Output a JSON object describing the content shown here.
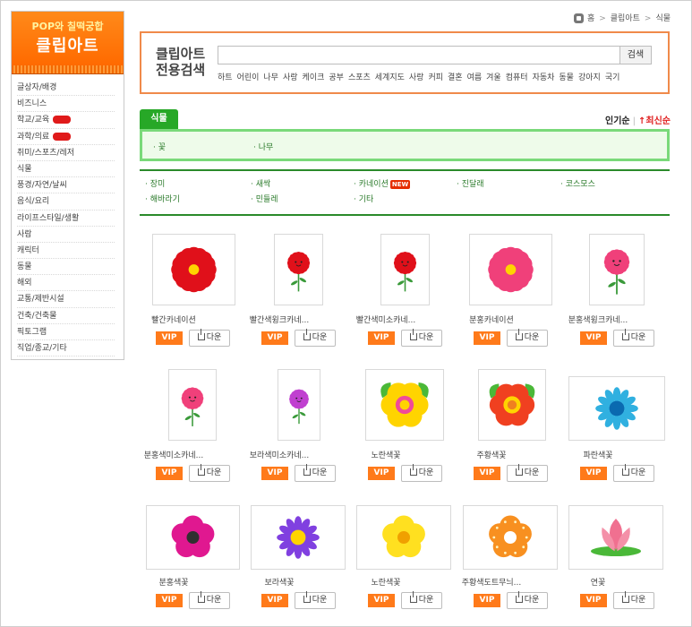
{
  "sidebar": {
    "logo_sub": "POP와 칠떡궁합",
    "logo_main": "클립아트",
    "categories": [
      {
        "label": "글상자/배경",
        "badge": false
      },
      {
        "label": "비즈니스",
        "badge": false
      },
      {
        "label": "학교/교육",
        "badge": true
      },
      {
        "label": "과학/의료",
        "badge": true
      },
      {
        "label": "취미/스포츠/레저",
        "badge": false
      },
      {
        "label": "식물",
        "badge": false
      },
      {
        "label": "풍경/자연/날씨",
        "badge": false
      },
      {
        "label": "음식/요리",
        "badge": false
      },
      {
        "label": "라이프스타일/생활",
        "badge": false
      },
      {
        "label": "사람",
        "badge": false
      },
      {
        "label": "캐릭터",
        "badge": false
      },
      {
        "label": "동물",
        "badge": false
      },
      {
        "label": "해외",
        "badge": false
      },
      {
        "label": "교통/제반시설",
        "badge": false
      },
      {
        "label": "건축/건축물",
        "badge": false
      },
      {
        "label": "픽토그램",
        "badge": false
      },
      {
        "label": "직업/종교/기타",
        "badge": false
      }
    ]
  },
  "breadcrumb": {
    "home": "홈",
    "items": [
      "클립아트",
      "식물"
    ]
  },
  "search": {
    "title_line1": "클립아트",
    "title_line2": "전용검색",
    "value": "",
    "button": "검색",
    "keywords": [
      "하트",
      "어린이",
      "나무",
      "사랑",
      "케이크",
      "공부",
      "스포츠",
      "세계지도",
      "사랑",
      "커피",
      "결혼",
      "여름",
      "겨울",
      "컴퓨터",
      "자동차",
      "동물",
      "강아지",
      "국기"
    ]
  },
  "tab": {
    "label": "식물"
  },
  "sort": {
    "popular": "인기순",
    "latest": "최신순"
  },
  "subcategories": [
    "꽃",
    "나무"
  ],
  "kinds": [
    {
      "label": "장미",
      "new": false
    },
    {
      "label": "새싹",
      "new": false
    },
    {
      "label": "카네이션",
      "new": true,
      "new_label": "NEW"
    },
    {
      "label": "진달래",
      "new": false
    },
    {
      "label": "코스모스",
      "new": false
    },
    {
      "label": "해바라기",
      "new": false
    },
    {
      "label": "민들레",
      "new": false
    },
    {
      "label": "기타",
      "new": false
    }
  ],
  "vip_label": "VIP",
  "down_label": "다운",
  "items": [
    {
      "name": "빨간카네이션",
      "icon": "red-carnation-icon",
      "color": "#e0101a"
    },
    {
      "name": "빨간색윙크카네...",
      "icon": "red-wink-carnation-icon",
      "color": "#e0101a"
    },
    {
      "name": "빨간색미소카네...",
      "icon": "red-smile-carnation-icon",
      "color": "#e0101a"
    },
    {
      "name": "분홍카네이션",
      "icon": "pink-carnation-icon",
      "color": "#f0407a"
    },
    {
      "name": "분홍색윙크카네...",
      "icon": "pink-wink-carnation-icon",
      "color": "#f0407a"
    },
    {
      "name": "분홍색미소카네...",
      "icon": "pink-smile-carnation-icon",
      "color": "#f0407a"
    },
    {
      "name": "보라색미소카네...",
      "icon": "purple-smile-carnation-icon",
      "color": "#c040d0"
    },
    {
      "name": "노란색꽃",
      "icon": "yellow-flower-icon",
      "color": "#ffd400"
    },
    {
      "name": "주황색꽃",
      "icon": "orange-flower-icon",
      "color": "#f04020"
    },
    {
      "name": "파란색꽃",
      "icon": "blue-flower-icon",
      "color": "#30b0e0"
    },
    {
      "name": "분홍색꽃",
      "icon": "pink-flower-icon",
      "color": "#e01890"
    },
    {
      "name": "보라색꽃",
      "icon": "purple-flower-icon",
      "color": "#8040e0"
    },
    {
      "name": "노란색꽃",
      "icon": "yellow-five-petal-icon",
      "color": "#ffe020"
    },
    {
      "name": "주황색도트무늬...",
      "icon": "orange-dot-flower-icon",
      "color": "#f89020"
    },
    {
      "name": "연꽃",
      "icon": "lotus-icon",
      "color": "#f07090"
    }
  ]
}
